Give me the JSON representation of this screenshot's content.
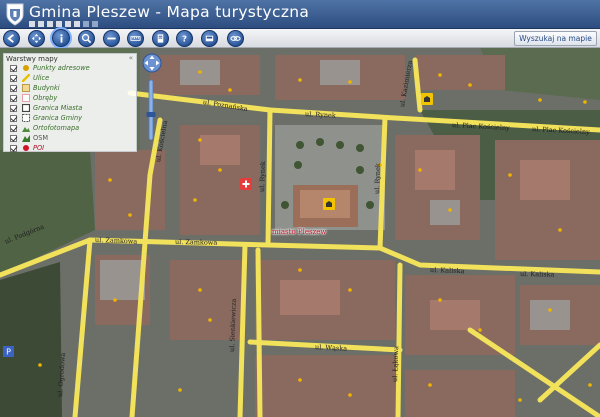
{
  "header": {
    "title": "Gmina Pleszew - Mapa turystyczna"
  },
  "toolbar": {
    "buttons": [
      {
        "name": "back-arrow-icon"
      },
      {
        "name": "pan-icon"
      },
      {
        "name": "info-icon",
        "active": true
      },
      {
        "name": "zoom-in-icon"
      },
      {
        "name": "zoom-out-icon"
      },
      {
        "name": "measure-icon"
      },
      {
        "name": "print-icon"
      },
      {
        "name": "help-icon"
      },
      {
        "name": "layers-icon"
      },
      {
        "name": "link-icon"
      }
    ],
    "search_map_label": "Wyszukaj na mapie"
  },
  "layers_panel": {
    "title": "Warstwy mapy",
    "close": "«",
    "items": [
      {
        "label": "Punkty adresowe",
        "checked": true,
        "icon": "address-point-icon",
        "color": "#d9a100"
      },
      {
        "label": "Ulice",
        "checked": true,
        "icon": "street-icon",
        "color": "#e6c200"
      },
      {
        "label": "Budynki",
        "checked": true,
        "icon": "building-icon",
        "color": "#f3d890"
      },
      {
        "label": "Obręby",
        "checked": true,
        "icon": "precinct-icon",
        "color": "#e7a0a8"
      },
      {
        "label": "Granica Miasta",
        "checked": true,
        "icon": "city-boundary-icon",
        "color": "#444444"
      },
      {
        "label": "Granica Gminy",
        "checked": true,
        "icon": "commune-boundary-icon",
        "color": "#555555"
      },
      {
        "label": "Ortofotomapa",
        "checked": true,
        "icon": "orthophoto-icon",
        "color": "#4c8a3c"
      },
      {
        "label": "OSM",
        "checked": false,
        "icon": "osm-icon",
        "color": "#3a7a2e"
      },
      {
        "label": "POI",
        "checked": true,
        "icon": "poi-icon",
        "color": "#d0142a"
      }
    ]
  },
  "map": {
    "town_label": "miasto Pleszew",
    "streets": [
      {
        "name": "ul. Poznańska"
      },
      {
        "name": "ul. Rynek"
      },
      {
        "name": "ul. Plac Kościelny"
      },
      {
        "name": "ul. Plac Kościelny"
      },
      {
        "name": "ul. Kazimierza"
      },
      {
        "name": "ul. Kościelna"
      },
      {
        "name": "ul. Rynek"
      },
      {
        "name": "ul. Rynek"
      },
      {
        "name": "ul. Podgórna"
      },
      {
        "name": "ul. Zamkowa"
      },
      {
        "name": "ul. Zamkowa"
      },
      {
        "name": "ul. Kaliska"
      },
      {
        "name": "ul. Kaliska"
      },
      {
        "name": "ul. Ogrodowa"
      },
      {
        "name": "ul. Sienkiewicza"
      },
      {
        "name": "ul. Wąska"
      },
      {
        "name": "ul. Łąkowa"
      }
    ]
  },
  "colors": {
    "header": "#3a5f94",
    "road": "#f2e15a",
    "town_label": "#d0142a",
    "poi_marker": "#f0b400"
  }
}
